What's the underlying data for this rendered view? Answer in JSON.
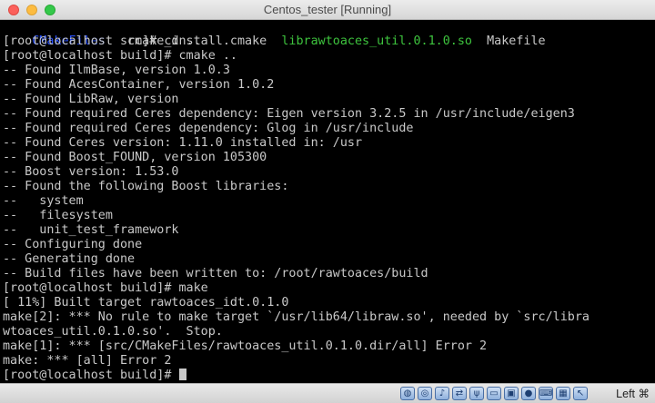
{
  "window": {
    "title": "Centos_tester [Running]"
  },
  "terminal": {
    "ls_row": [
      {
        "text": "CMakeFiles",
        "color": "#2a52ff"
      },
      {
        "text": "   cmake_install.cmake  ",
        "color": "#c9c9c9"
      },
      {
        "text": "librawtoaces_util.0.1.0.so",
        "color": "#3ec43e"
      },
      {
        "text": "  Makefile",
        "color": "#c9c9c9"
      }
    ],
    "lines": [
      "[root@localhost src]# cd ..",
      "[root@localhost build]# cmake ..",
      "-- Found IlmBase, version 1.0.3",
      "-- Found AcesContainer, version 1.0.2",
      "-- Found LibRaw, version",
      "-- Found required Ceres dependency: Eigen version 3.2.5 in /usr/include/eigen3",
      "-- Found required Ceres dependency: Glog in /usr/include",
      "-- Found Ceres version: 1.11.0 installed in: /usr",
      "-- Found Boost_FOUND, version 105300",
      "-- Boost version: 1.53.0",
      "-- Found the following Boost libraries:",
      "--   system",
      "--   filesystem",
      "--   unit_test_framework",
      "-- Configuring done",
      "-- Generating done",
      "-- Build files have been written to: /root/rawtoaces/build",
      "[root@localhost build]# make",
      "[ 11%] Built target rawtoaces_idt.0.1.0",
      "make[2]: *** No rule to make target `/usr/lib64/libraw.so', needed by `src/libra",
      "wtoaces_util.0.1.0.so'.  Stop.",
      "make[1]: *** [src/CMakeFiles/rawtoaces_util.0.1.0.dir/all] Error 2",
      "make: *** [all] Error 2"
    ],
    "prompt": "[root@localhost build]# "
  },
  "statusbar": {
    "icons": [
      "hard-disk-icon",
      "optical-disc-icon",
      "audio-icon",
      "network-icon",
      "usb-icon",
      "shared-folder-icon",
      "display-icon",
      "video-capture-icon",
      "keyboard-icon",
      "cpu-icon",
      "mouse-integration-icon"
    ],
    "host_key": "Left ⌘"
  }
}
